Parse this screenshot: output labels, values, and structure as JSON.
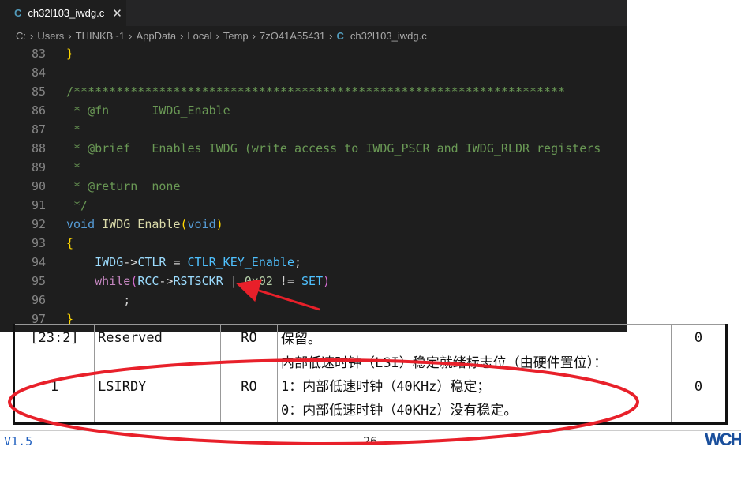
{
  "editor": {
    "tab": {
      "icon": "c-file-icon",
      "icon_text": "C",
      "label": "ch32l103_iwdg.c",
      "close": "✕"
    },
    "breadcrumb": [
      "C:",
      "Users",
      "THINKB~1",
      "AppData",
      "Local",
      "Temp",
      "7zO41A55431"
    ],
    "breadcrumb_file": "ch32l103_iwdg.c",
    "lines": [
      {
        "n": "83",
        "t": [
          [
            "}",
            "b"
          ]
        ]
      },
      {
        "n": "84",
        "t": []
      },
      {
        "n": "85",
        "t": [
          [
            "/*********************************************************************",
            "c"
          ]
        ]
      },
      {
        "n": "86",
        "t": [
          [
            " * @fn      IWDG_Enable",
            "c"
          ]
        ]
      },
      {
        "n": "87",
        "t": [
          [
            " *",
            "c"
          ]
        ]
      },
      {
        "n": "88",
        "t": [
          [
            " * @brief   Enables IWDG (write access to IWDG_PSCR and IWDG_RLDR registers",
            "c"
          ]
        ]
      },
      {
        "n": "89",
        "t": [
          [
            " *",
            "c"
          ]
        ]
      },
      {
        "n": "90",
        "t": [
          [
            " * @return  none",
            "c"
          ]
        ]
      },
      {
        "n": "91",
        "t": [
          [
            " */",
            "c"
          ]
        ]
      },
      {
        "n": "92",
        "t": [
          [
            "void",
            "k"
          ],
          [
            " ",
            "w"
          ],
          [
            "IWDG_Enable",
            "f"
          ],
          [
            "(",
            "b"
          ],
          [
            "void",
            "k"
          ],
          [
            ")",
            "b"
          ]
        ]
      },
      {
        "n": "93",
        "t": [
          [
            "{",
            "b"
          ]
        ]
      },
      {
        "n": "94",
        "t": [
          [
            "    ",
            "w"
          ],
          [
            "IWDG",
            "v"
          ],
          [
            "->",
            "w"
          ],
          [
            "CTLR",
            "v"
          ],
          [
            " = ",
            "w"
          ],
          [
            "CTLR_KEY_Enable",
            "m"
          ],
          [
            ";",
            "w"
          ]
        ]
      },
      {
        "n": "95",
        "t": [
          [
            "    ",
            "w"
          ],
          [
            "while",
            "p"
          ],
          [
            "(",
            "bp"
          ],
          [
            "RCC",
            "v"
          ],
          [
            "->",
            "w"
          ],
          [
            "RSTSCKR",
            "v"
          ],
          [
            " | ",
            "w"
          ],
          [
            "0x02",
            "n"
          ],
          [
            " != ",
            "w"
          ],
          [
            "SET",
            "m"
          ],
          [
            ")",
            "bp"
          ]
        ]
      },
      {
        "n": "96",
        "t": [
          [
            "        ;",
            "w"
          ]
        ]
      },
      {
        "n": "97",
        "t": [
          [
            "}",
            "b"
          ]
        ]
      }
    ]
  },
  "document": {
    "rows": [
      {
        "bits": "[23:2]",
        "name": "Reserved",
        "access": "RO",
        "desc": [
          "保留。"
        ],
        "reset": "0"
      },
      {
        "bits": "1",
        "name": "LSIRDY",
        "access": "RO",
        "desc": [
          "内部低速时钟（LSI）稳定就绪标志位（由硬件置位）：",
          "1：内部低速时钟（40KHz）稳定；",
          "0：内部低速时钟（40KHz）没有稳定。"
        ],
        "reset": "0"
      }
    ],
    "footer": {
      "version": "V1.5",
      "page": "26",
      "logo": "WCH"
    }
  },
  "annotations": {
    "color": "#e8202a",
    "arrow": "arrow-pointing-to-operator",
    "ellipse": "ellipse-around-LSIRDY-row"
  }
}
